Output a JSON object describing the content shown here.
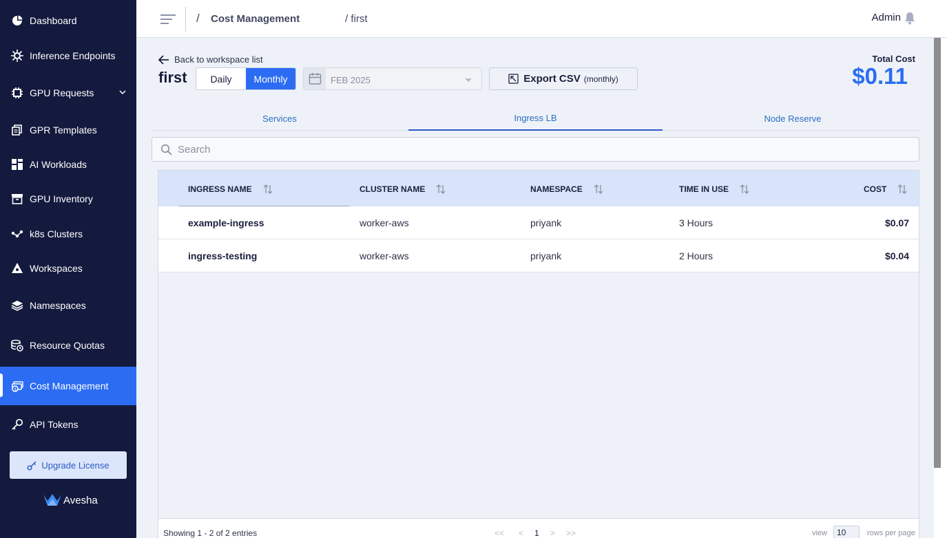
{
  "sidebar": {
    "items": [
      {
        "label": "Dashboard",
        "icon": "dashboard-icon"
      },
      {
        "label": "Inference Endpoints",
        "icon": "inference-icon"
      },
      {
        "label": "GPU Requests",
        "icon": "chip-icon"
      },
      {
        "label": "GPR Templates",
        "icon": "templates-icon"
      },
      {
        "label": "AI Workloads",
        "icon": "workloads-icon"
      },
      {
        "label": "GPU Inventory",
        "icon": "inventory-icon"
      },
      {
        "label": "k8s Clusters",
        "icon": "clusters-icon"
      },
      {
        "label": "Workspaces",
        "icon": "workspaces-icon"
      },
      {
        "label": "Namespaces",
        "icon": "layers-icon"
      },
      {
        "label": "Resource Quotas",
        "icon": "quota-icon"
      },
      {
        "label": "Cost Management",
        "icon": "cost-icon",
        "active": true
      },
      {
        "label": "API Tokens",
        "icon": "key-icon"
      }
    ],
    "upgrade_label": "Upgrade License",
    "brand": "Avesha"
  },
  "topbar": {
    "crumb_sep": "/",
    "crumb_1": "Cost Management",
    "crumb_2": "/ first",
    "user": "Admin"
  },
  "header": {
    "back_label": "Back to workspace list",
    "workspace": "first",
    "toggle": {
      "daily": "Daily",
      "monthly": "Monthly",
      "selected": "Monthly"
    },
    "date": "FEB 2025",
    "export_label": "Export CSV",
    "export_sub": "(monthly)",
    "total_label": "Total Cost",
    "total_value": "$0.11"
  },
  "tabs": [
    {
      "label": "Services"
    },
    {
      "label": "Ingress LB",
      "active": true
    },
    {
      "label": "Node Reserve"
    }
  ],
  "search": {
    "placeholder": "Search"
  },
  "table": {
    "columns": [
      "INGRESS NAME",
      "CLUSTER NAME",
      "NAMESPACE",
      "TIME IN USE",
      "COST"
    ],
    "rows": [
      [
        "example-ingress",
        "worker-aws",
        "priyank",
        "3 Hours",
        "$0.07"
      ],
      [
        "ingress-testing",
        "worker-aws",
        "priyank",
        "2 Hours",
        "$0.04"
      ]
    ]
  },
  "pagination": {
    "showing": "Showing 1 - 2 of 2 entries",
    "first": "<<",
    "prev": "<",
    "page": "1",
    "next": ">",
    "last": ">>",
    "view_label": "view",
    "rows_per_page": "10",
    "rows_label": "rows per page"
  },
  "colors": {
    "sidebar": "#141a3e",
    "accent": "#2b6cf2",
    "main_bg": "#eef2f8",
    "table_header": "#d7e4fa"
  }
}
